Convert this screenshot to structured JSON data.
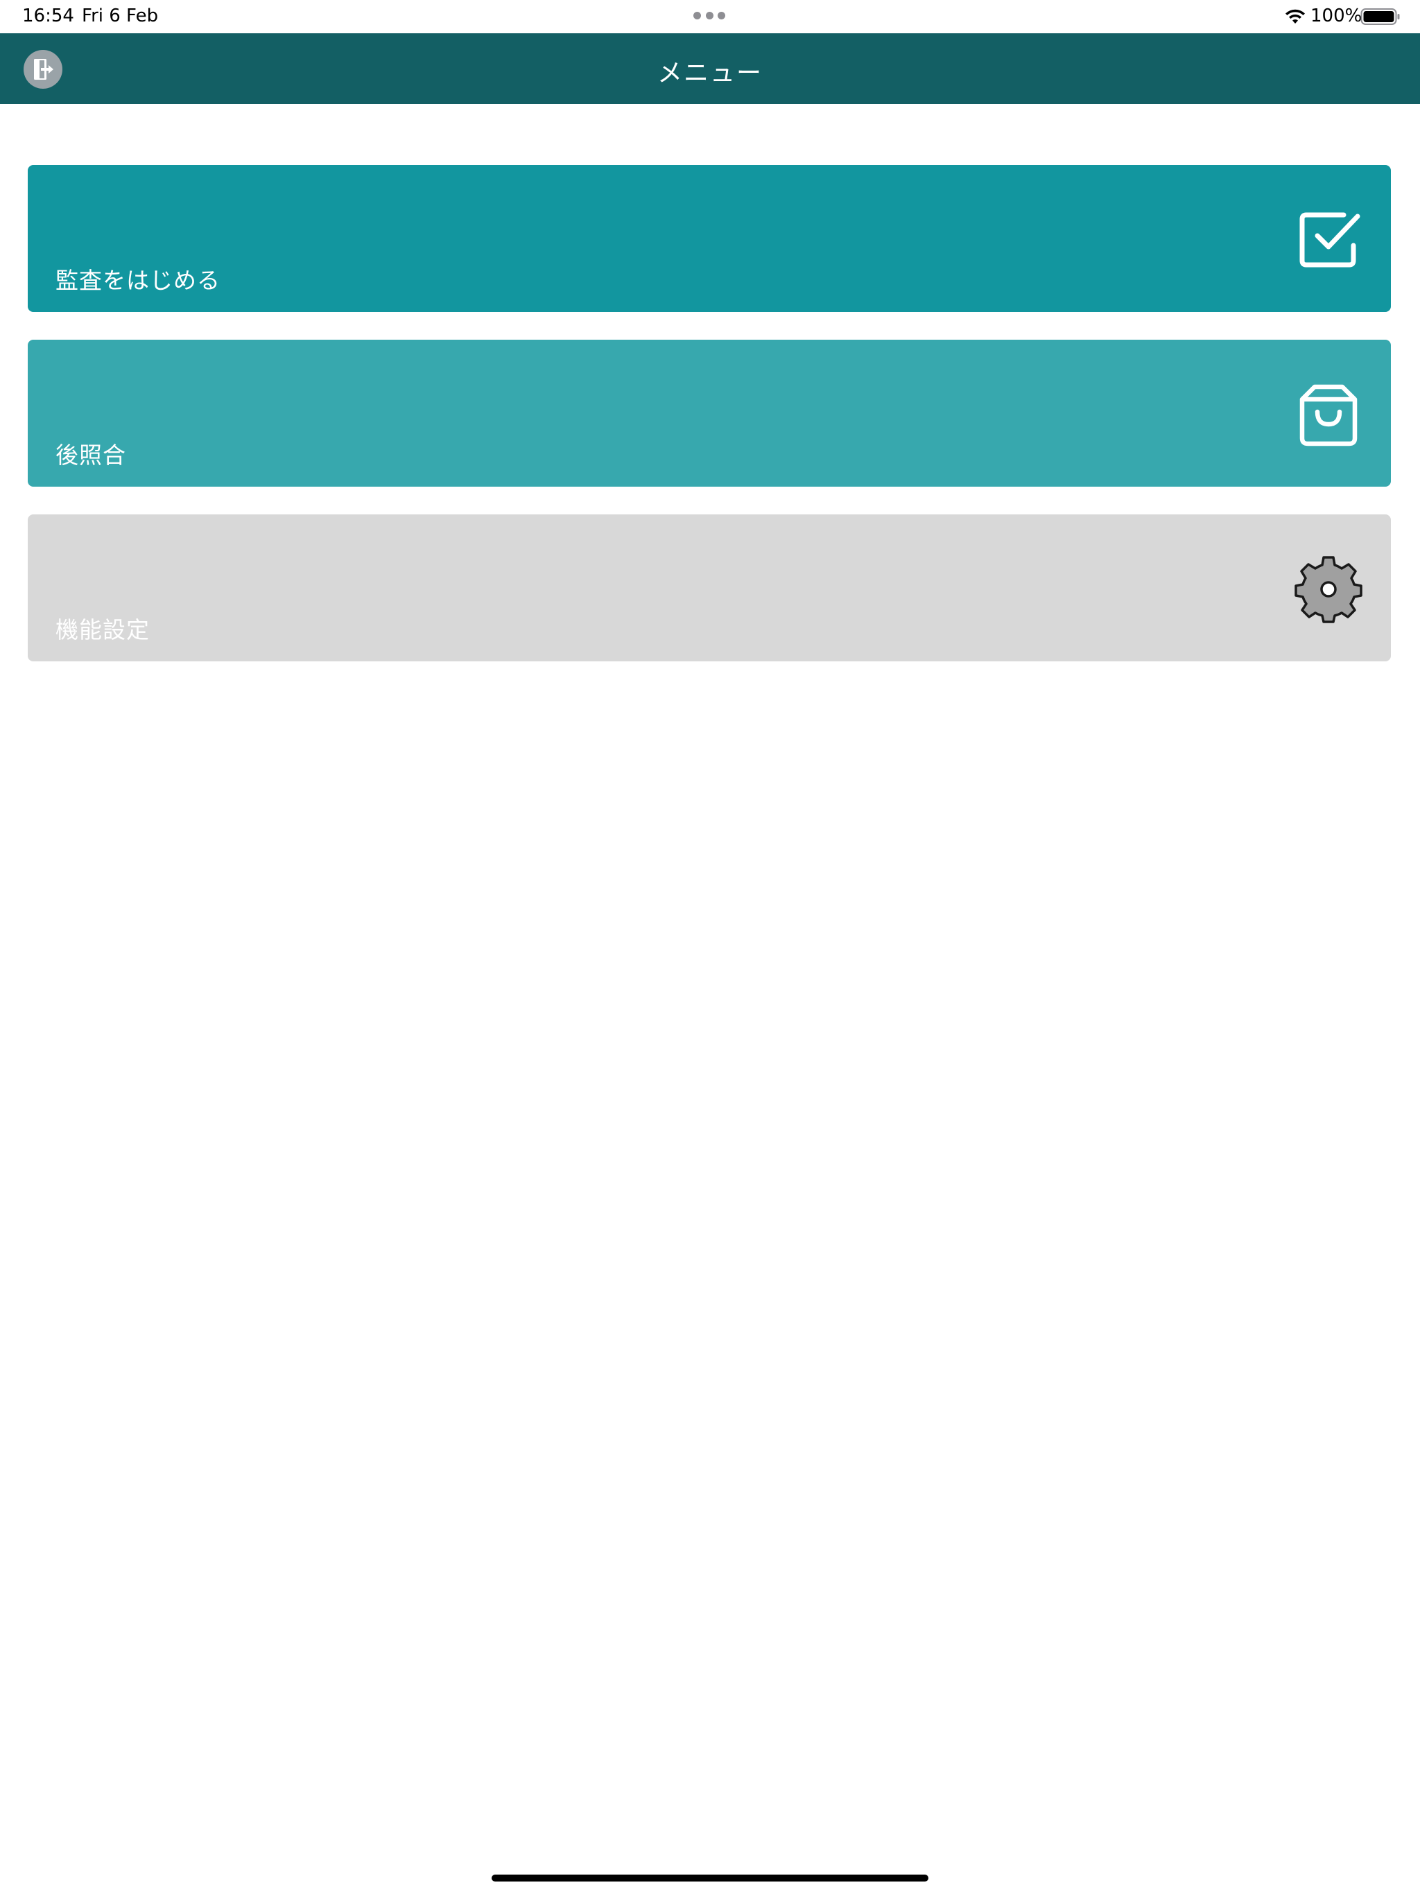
{
  "status_bar": {
    "time": "16:54",
    "date": "Fri 6 Feb",
    "battery": "100%"
  },
  "nav": {
    "title": "メニュー",
    "logout_icon": "logout-door-icon",
    "color": "#135f64"
  },
  "menu": {
    "items": [
      {
        "label": "監査をはじめる",
        "icon": "checkbox-checked-icon",
        "color": "#12969f"
      },
      {
        "label": "後照合",
        "icon": "shopping-bag-icon",
        "color": "#37a8ae"
      },
      {
        "label": "機能設定",
        "icon": "gear-icon",
        "color": "#d8d8d8"
      }
    ]
  }
}
